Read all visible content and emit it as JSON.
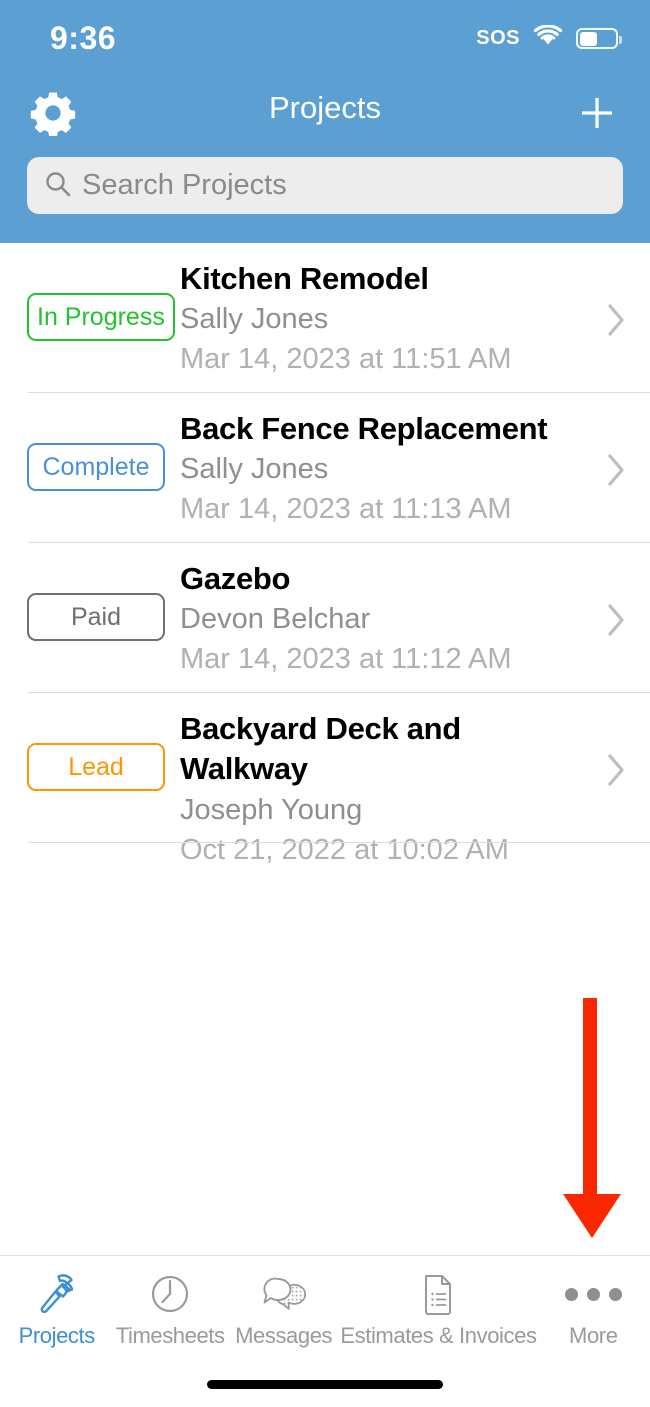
{
  "status_bar": {
    "time": "9:36",
    "sos_label": "SOS",
    "wifi_icon": "wifi-icon",
    "battery_icon": "battery-icon",
    "battery_level_percent": 46
  },
  "header": {
    "title": "Projects",
    "settings_icon": "gear-icon",
    "add_icon": "plus-icon",
    "background_color": "#5CA0D3",
    "search": {
      "placeholder": "Search Projects",
      "value": "",
      "icon": "search-icon"
    }
  },
  "colors": {
    "accent_blue": "#3C8FD4",
    "header_blue": "#5CA0D3",
    "status_in_progress": "#22C32E",
    "status_complete": "#4A90D9",
    "status_paid": "#6E6E73",
    "status_lead": "#FF9500",
    "annotation_red": "#FA2800"
  },
  "list": {
    "rows": [
      {
        "status": "In Progress",
        "status_color": "#22C32E",
        "title": "Kitchen Remodel",
        "client": "Sally Jones",
        "date": "Mar 14, 2023 at 11:51 AM",
        "chevron_icon": "chevron-right-icon"
      },
      {
        "status": "Complete",
        "status_color": "#4A90D9",
        "title": "Back Fence Replacement",
        "client": "Sally Jones",
        "date": "Mar 14, 2023 at 11:13 AM",
        "chevron_icon": "chevron-right-icon"
      },
      {
        "status": "Paid",
        "status_color": "#6E6E73",
        "title": "Gazebo",
        "client": "Devon Belchar",
        "date": "Mar 14, 2023 at 11:12 AM",
        "chevron_icon": "chevron-right-icon"
      },
      {
        "status": "Lead",
        "status_color": "#FF9500",
        "title": "Backyard Deck and Walkway",
        "client": "Joseph Young",
        "date": "Oct 21, 2022 at 10:02 AM",
        "chevron_icon": "chevron-right-icon"
      }
    ]
  },
  "tab_bar": {
    "active_index": 0,
    "tabs": [
      {
        "label": "Projects",
        "icon": "hammer-icon"
      },
      {
        "label": "Timesheets",
        "icon": "clock-icon"
      },
      {
        "label": "Messages",
        "icon": "speech-bubbles-icon"
      },
      {
        "label": "Estimates & Invoices",
        "icon": "document-list-icon"
      },
      {
        "label": "More",
        "icon": "ellipsis-icon"
      }
    ]
  },
  "annotation": {
    "type": "arrow-down",
    "color": "#FA2800",
    "points_at": "More"
  },
  "home_indicator": "home-indicator"
}
